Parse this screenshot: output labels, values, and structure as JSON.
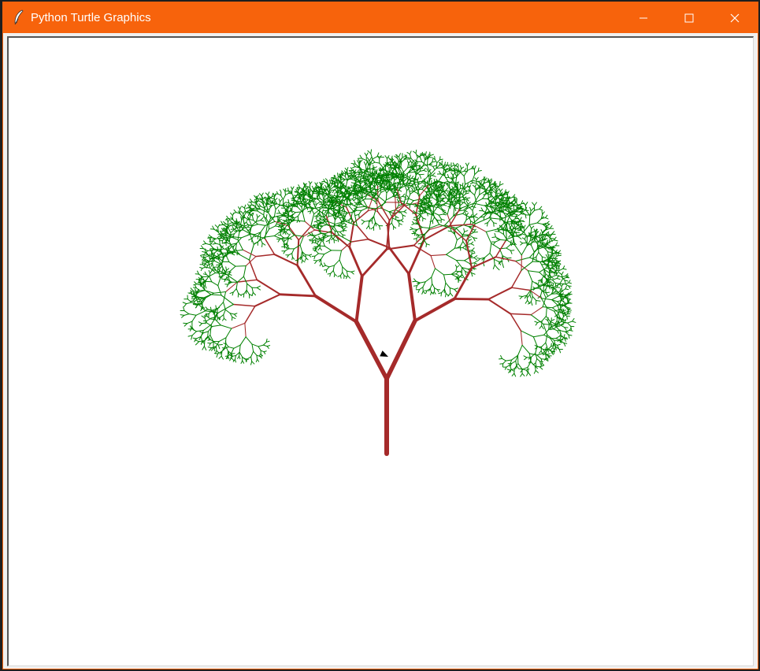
{
  "window": {
    "title": "Python Turtle Graphics",
    "title_icon": "feather-icon",
    "accent_color": "#f7630c",
    "controls": {
      "minimize_icon": "minimize-icon",
      "maximize_icon": "maximize-icon",
      "close_icon": "close-icon"
    }
  },
  "canvas": {
    "background": "#ffffff",
    "drawing": "recursive fractal tree",
    "trunk_color": "#a52a2a",
    "leaf_color": "#008000",
    "turtle_cursor": "arrow-cursor-icon"
  }
}
